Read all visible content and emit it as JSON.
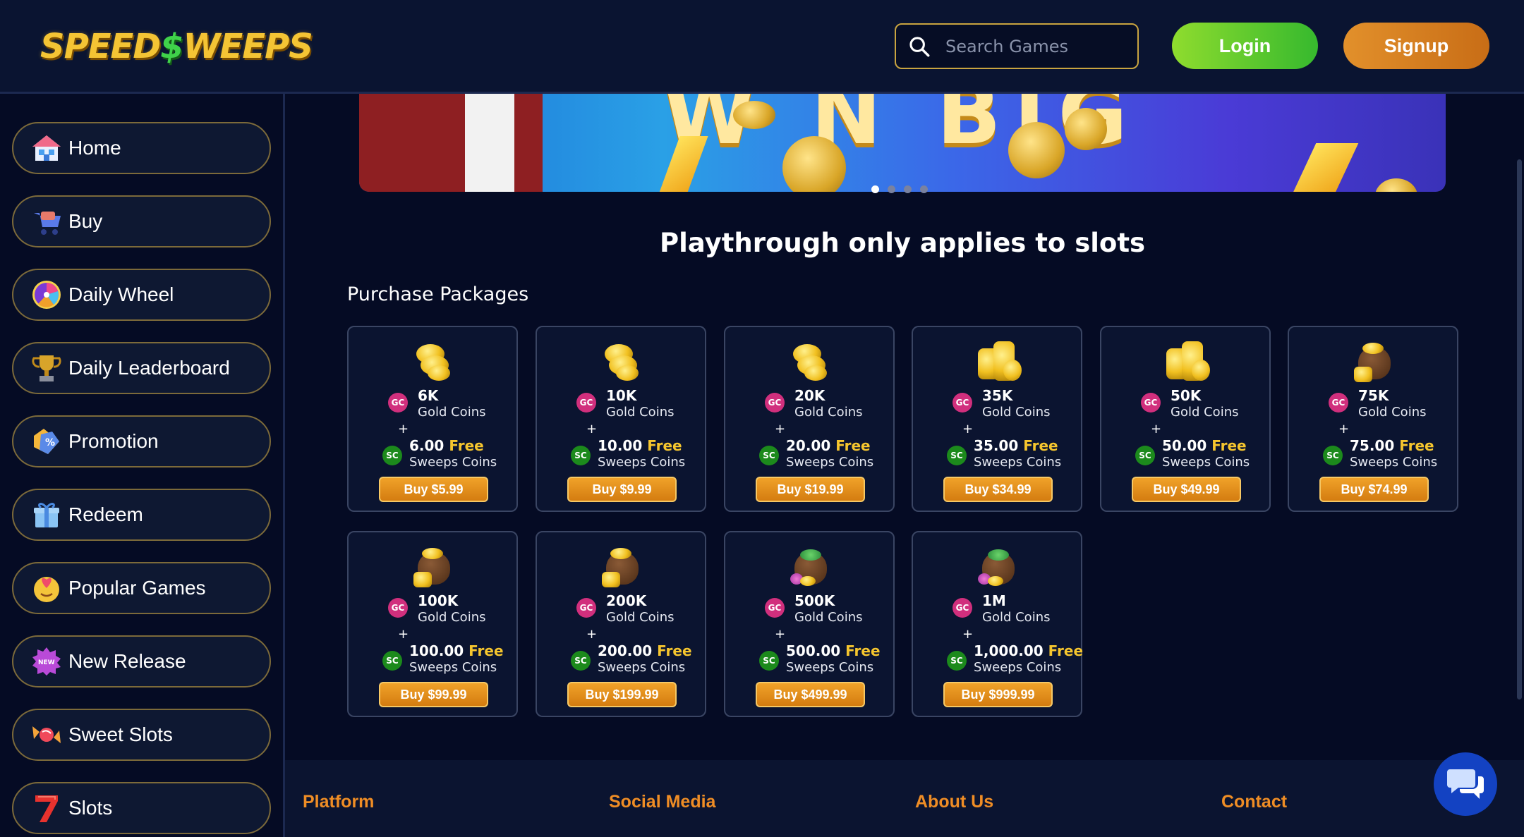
{
  "header": {
    "logo_text_left": "SPEED",
    "logo_text_symbol": "$",
    "logo_text_right": "WEEPS",
    "search_placeholder": "Search Games",
    "login_label": "Login",
    "signup_label": "Signup"
  },
  "sidebar": {
    "items": [
      {
        "label": "Home",
        "icon": "home-icon"
      },
      {
        "label": "Buy",
        "icon": "cart-icon"
      },
      {
        "label": "Daily Wheel",
        "icon": "wheel-icon"
      },
      {
        "label": "Daily Leaderboard",
        "icon": "trophy-icon"
      },
      {
        "label": "Promotion",
        "icon": "promotion-tag-icon"
      },
      {
        "label": "Redeem",
        "icon": "gift-icon"
      },
      {
        "label": "Popular Games",
        "icon": "heart-face-icon"
      },
      {
        "label": "New Release",
        "icon": "new-badge-icon"
      },
      {
        "label": "Sweet Slots",
        "icon": "candy-icon"
      },
      {
        "label": "Slots",
        "icon": "seven-icon"
      }
    ]
  },
  "banner": {
    "slide_count": 4,
    "active_slide": 1
  },
  "main": {
    "notice": "Playthrough only applies to slots",
    "section_title": "Purchase Packages",
    "gc_badge": "GC",
    "sc_badge": "SC",
    "gc_label": "Gold Coins",
    "sc_label": "Sweeps Coins",
    "plus": "+",
    "free_label": "Free",
    "packages": [
      {
        "gc": "6K",
        "sc": "6.00",
        "buy": "Buy $5.99",
        "icon": "coin-stack-small-icon"
      },
      {
        "gc": "10K",
        "sc": "10.00",
        "buy": "Buy $9.99",
        "icon": "coin-stack-small-icon"
      },
      {
        "gc": "20K",
        "sc": "20.00",
        "buy": "Buy $19.99",
        "icon": "coin-stack-small-icon"
      },
      {
        "gc": "35K",
        "sc": "35.00",
        "buy": "Buy $34.99",
        "icon": "coin-stack-large-icon"
      },
      {
        "gc": "50K",
        "sc": "50.00",
        "buy": "Buy $49.99",
        "icon": "coin-stack-large-icon"
      },
      {
        "gc": "75K",
        "sc": "75.00",
        "buy": "Buy $74.99",
        "icon": "coin-bag-icon"
      },
      {
        "gc": "100K",
        "sc": "100.00",
        "buy": "Buy $99.99",
        "icon": "coin-bag-icon"
      },
      {
        "gc": "200K",
        "sc": "200.00",
        "buy": "Buy $199.99",
        "icon": "coin-bag-icon"
      },
      {
        "gc": "500K",
        "sc": "500.00",
        "buy": "Buy $499.99",
        "icon": "treasure-bag-icon"
      },
      {
        "gc": "1M",
        "sc": "1,000.00",
        "buy": "Buy $999.99",
        "icon": "treasure-bag-icon"
      }
    ]
  },
  "footer": {
    "columns": [
      "Platform",
      "Social Media",
      "About Us",
      "Contact"
    ]
  },
  "colors": {
    "background": "#050b24",
    "accent_gold": "#f6c62e",
    "footer_heading": "#ef8d25",
    "gc_badge": "#d12f7d",
    "sc_badge": "#1c8a1c"
  }
}
